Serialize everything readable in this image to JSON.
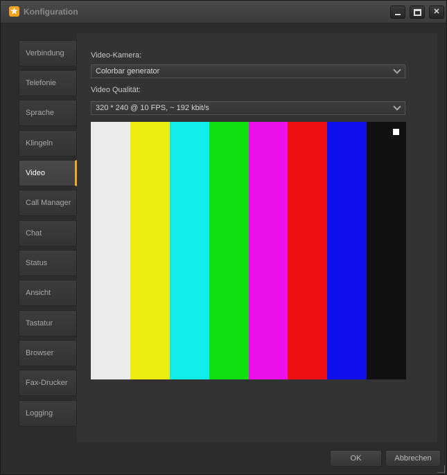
{
  "window": {
    "title": "Konfiguration",
    "icon": "app-star-icon"
  },
  "sidebar": {
    "items": [
      {
        "label": "Verbindung",
        "active": false
      },
      {
        "label": "Telefonie",
        "active": false
      },
      {
        "label": "Sprache",
        "active": false
      },
      {
        "label": "Klingeln",
        "active": false
      },
      {
        "label": "Video",
        "active": true
      },
      {
        "label": "Call Manager",
        "active": false
      },
      {
        "label": "Chat",
        "active": false
      },
      {
        "label": "Status",
        "active": false
      },
      {
        "label": "Ansicht",
        "active": false
      },
      {
        "label": "Tastatur",
        "active": false
      },
      {
        "label": "Browser",
        "active": false
      },
      {
        "label": "Fax-Drucker",
        "active": false
      },
      {
        "label": "Logging",
        "active": false
      }
    ]
  },
  "content": {
    "camera_label": "Video-Kamera:",
    "camera_value": "Colorbar generator",
    "quality_label": "Video Qualität:",
    "quality_value": "320 * 240 @ 10 FPS, ~ 192 kbit/s",
    "colorbars": [
      "#ebebeb",
      "#ecec10",
      "#10ecec",
      "#10e010",
      "#ec10ec",
      "#ec1010",
      "#1010ec",
      "#101010"
    ]
  },
  "footer": {
    "ok_label": "OK",
    "cancel_label": "Abbrechen"
  },
  "colors": {
    "accent": "#f5a623"
  }
}
